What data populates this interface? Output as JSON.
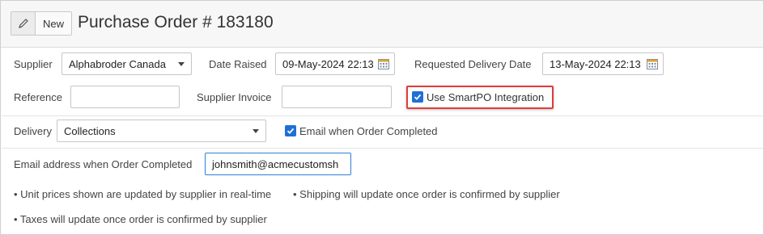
{
  "header": {
    "new_label": "New",
    "title": "Purchase Order # 183180"
  },
  "form": {
    "supplier_label": "Supplier",
    "supplier_value": "Alphabroder Canada",
    "date_raised_label": "Date Raised",
    "date_raised_value": "09-May-2024 22:13",
    "requested_delivery_label": "Requested Delivery Date",
    "requested_delivery_value": "13-May-2024 22:13",
    "reference_label": "Reference",
    "reference_value": "",
    "supplier_invoice_label": "Supplier Invoice",
    "supplier_invoice_value": "",
    "smartpo_label": "Use SmartPO Integration",
    "smartpo_checked": true,
    "delivery_label": "Delivery",
    "delivery_value": "Collections",
    "email_when_completed_label": "Email when Order Completed",
    "email_when_completed_checked": true,
    "email_address_label": "Email address when Order Completed",
    "email_address_value": "johnsmith@acmecustomsh"
  },
  "notes": [
    "• Unit prices shown are updated by supplier in real-time",
    "• Shipping will update once order is confirmed by supplier",
    "• Taxes will update once order is confirmed by supplier"
  ],
  "colors": {
    "accent": "#1f6fd6",
    "highlight": "#e03c3c"
  }
}
